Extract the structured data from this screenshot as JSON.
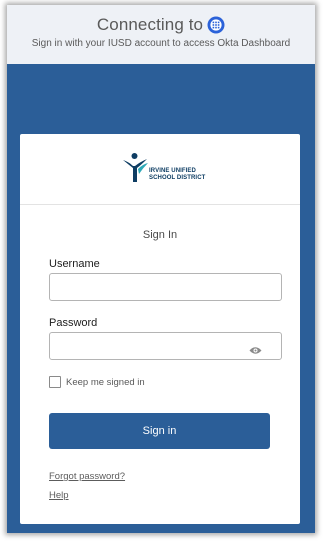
{
  "header": {
    "title": "Connecting to",
    "subtitle": "Sign in with your IUSD account to access Okta Dashboard"
  },
  "logo": {
    "line1": "IRVINE UNIFIED",
    "line2": "SCHOOL DISTRICT"
  },
  "form": {
    "title": "Sign In",
    "username_label": "Username",
    "username_value": "",
    "password_label": "Password",
    "password_value": "",
    "remember_label": "Keep me signed in",
    "remember_checked": false,
    "submit_label": "Sign in"
  },
  "links": {
    "forgot_password": "Forgot password?",
    "help": "Help"
  },
  "colors": {
    "brand": "#2b5e98",
    "okta_icon": "#2b62d9",
    "logo_navy": "#0e3d63",
    "logo_teal": "#2fa9b8"
  },
  "icons": {
    "okta": "okta-dashboard-icon",
    "show_password": "eye-icon",
    "logo": "irvine-unified-logo-icon"
  }
}
